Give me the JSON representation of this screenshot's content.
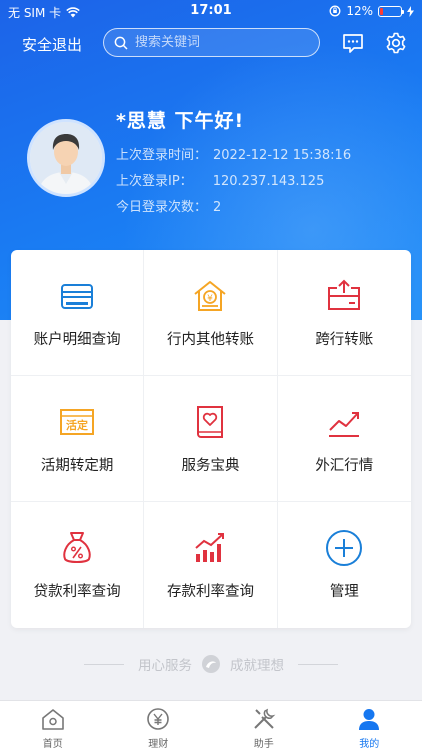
{
  "status_bar": {
    "carrier": "无 SIM 卡",
    "time": "17:01",
    "battery": "12%"
  },
  "header": {
    "logout_label": "安全退出",
    "search_placeholder": "搜索关键词"
  },
  "user": {
    "greeting": "*思慧  下午好!",
    "last_login_time_label": "上次登录时间：",
    "last_login_time": "2022-12-12 15:38:16",
    "last_login_ip_label": "上次登录IP：",
    "last_login_ip": "120.237.143.125",
    "today_login_count_label": "今日登录次数：",
    "today_login_count": "2"
  },
  "menu": [
    {
      "label": "账户明细查询",
      "icon": "account-detail-icon"
    },
    {
      "label": "行内其他转账",
      "icon": "internal-transfer-icon"
    },
    {
      "label": "跨行转账",
      "icon": "interbank-transfer-icon"
    },
    {
      "label": "活期转定期",
      "icon": "current-to-fixed-icon"
    },
    {
      "label": "服务宝典",
      "icon": "service-guide-icon"
    },
    {
      "label": "外汇行情",
      "icon": "forex-market-icon"
    },
    {
      "label": "贷款利率查询",
      "icon": "loan-rate-icon"
    },
    {
      "label": "存款利率查询",
      "icon": "deposit-rate-icon"
    },
    {
      "label": "管理",
      "icon": "add-manage-icon"
    }
  ],
  "icon_texts": {
    "current_to_fixed": "活定",
    "yen": "¥"
  },
  "slogan": {
    "left": "用心服务",
    "right": "成就理想"
  },
  "tabs": [
    {
      "label": "首页",
      "icon": "home-icon",
      "active": false
    },
    {
      "label": "理财",
      "icon": "finance-icon",
      "active": false
    },
    {
      "label": "助手",
      "icon": "tools-icon",
      "active": false
    },
    {
      "label": "我的",
      "icon": "profile-icon",
      "active": true
    }
  ],
  "colors": {
    "primary": "#1677f0",
    "blue_icon": "#1a7fd8",
    "orange_icon": "#f5a524",
    "red_icon": "#e0323f",
    "battery_low": "#ff3b30"
  }
}
